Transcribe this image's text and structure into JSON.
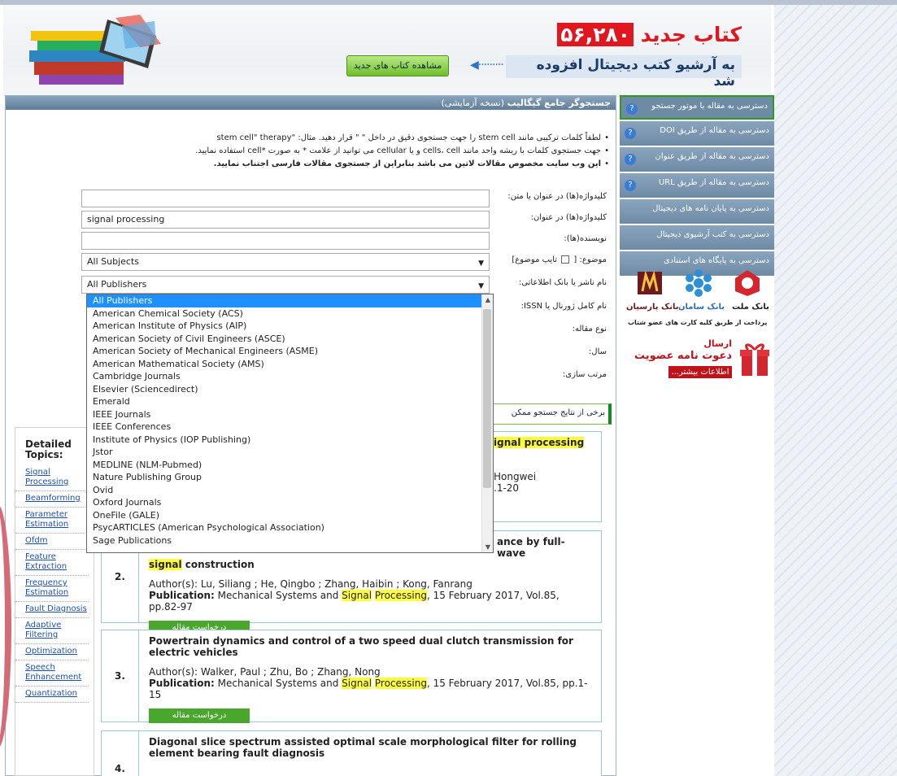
{
  "banner": {
    "title_number": "۵۶,۲۸۰",
    "title_text": "کتاب جدید",
    "subtitle": "به آرشیو کتب دیجیتال افزوده شد",
    "arrow": "◀·········",
    "view_button": "مشاهده کتاب های جدید"
  },
  "search_panel": {
    "title_bold": "جستجوگر جامع گیگالیب",
    "title_rest": "(نسخه آزمایشی)",
    "notes": [
      "لطفاً کلمات ترکیبی مانند stem cell را جهت جستجوی دقیق در داخل \" \" قرار دهید. مثال: \"stem cell\" therapy",
      "جهت جستجوی کلمات با ریشه واحد مانند cells، cell و یا cellular می توانید از علامت * به صورت *cell استفاده نمایید.",
      "این وب سایت مخصوص مقالات لاتین می باشد بنابراین از جستجوی مقالات فارسی اجتناب نمایید."
    ],
    "fields": {
      "keywords_text_label": "کلیدواژه(ها) در عنوان یا متن:",
      "keywords_text_value": "",
      "keywords_title_label": "کلیدواژه(ها) در عنوان:",
      "keywords_title_value": "signal processing",
      "authors_label": "نویسنده(ها):",
      "authors_value": "",
      "subject_label": "موضوع: [ ",
      "subject_label_tail": " تایپ موضوع]",
      "subject_value": "All Subjects",
      "publisher_label": "نام ناشر یا بانک اطلاعاتی:",
      "publisher_value": "All Publishers",
      "issn_label": "نام کامل ژورنال یا ISSN:",
      "type_label": "نوع مقاله:",
      "year_label": "سال:",
      "sort_label": "مرتب سازی:"
    },
    "publisher_options": [
      "All Publishers",
      "American Chemical Society (ACS)",
      "American Institute of Physics (AIP)",
      "American Society of Civil Engineers (ASCE)",
      "American Society of Mechanical Engineers (ASME)",
      "American Mathematical Society (AMS)",
      "Cambridge Journals",
      "Elsevier (Sciencedirect)",
      "Emerald",
      "IEEE Journals",
      "IEEE Conferences",
      "Institute of Physics (IOP Publishing)",
      "Jstor",
      "MEDLINE (NLM-Pubmed)",
      "Nature Publishing Group",
      "Ovid",
      "Oxford Journals",
      "OneFile (GALE)",
      "PsycARTICLES (American Psychological Association)",
      "Sage Publications"
    ],
    "results_notice": "برخی از نتایج جستجو ممکن"
  },
  "topics": {
    "heading": "Detailed Topics:",
    "items": [
      "Signal Processing",
      "Beamforming",
      "Parameter Estimation",
      "Ofdm",
      "Feature Extraction",
      "Frequency Estimation",
      "Fault Diagnosis",
      "Adaptive Filtering",
      "Optimization",
      "Speech Enhancement",
      "Quantization"
    ]
  },
  "results": [
    {
      "num": "1.",
      "title_visible": "ignal processing",
      "authors_visible": "Hongwei",
      "publication_visible": ".1-20"
    },
    {
      "num": "2.",
      "title_visible_a": "ance by full-wave",
      "title_visible_b": "signal",
      "title_visible_c": " construction",
      "authors_label": "Author(s):",
      "authors": " Lu, Siliang ; He, Qingbo ; Zhang, Haibin ; Kong, Fanrang",
      "publication_label": "Publication:",
      "publication_pre": " Mechanical Systems and ",
      "hl1": "Signal",
      "hl2": "Processing",
      "publication_post": ", 15 February 2017, Vol.85, pp.82-97",
      "button": "درخواست مقاله"
    },
    {
      "num": "3.",
      "title": "Powertrain dynamics and control of a two speed dual clutch transmission for electric vehicles",
      "authors_label": "Author(s):",
      "authors": " Walker, Paul ; Zhu, Bo ; Zhang, Nong",
      "publication_label": "Publication:",
      "publication_pre": " Mechanical Systems and ",
      "hl1": "Signal",
      "hl2": "Processing",
      "publication_post": ", 15 February 2017, Vol.85, pp.1-15",
      "button": "درخواست مقاله"
    },
    {
      "num": "4.",
      "title": "Diagonal slice spectrum assisted optimal scale morphological filter for rolling element bearing fault diagnosis"
    }
  ],
  "sidebar": {
    "items": [
      "دسترسی به مقاله با موتور جستجو",
      "دسترسی به مقاله از طریق DOI",
      "دسترسی به مقاله از طریق عنوان",
      "دسترسی به مقاله از طریق URL",
      "دسترسی به پایان نامه های دیجیتال",
      "دسترسی به کتب آرشیوی دیجیتال",
      "دسترسی به پایگاه های استنادی"
    ],
    "banks": [
      "بانک ملت",
      "بانک سامان",
      "بانک پارسیان"
    ],
    "bank_note": "پرداخت از طریق کلیه کارت های عضو شتاب",
    "invite_t1": "ارسال",
    "invite_t2": "دعوت نامه عضویت",
    "invite_more": "اطلاعات بیشتر..."
  }
}
